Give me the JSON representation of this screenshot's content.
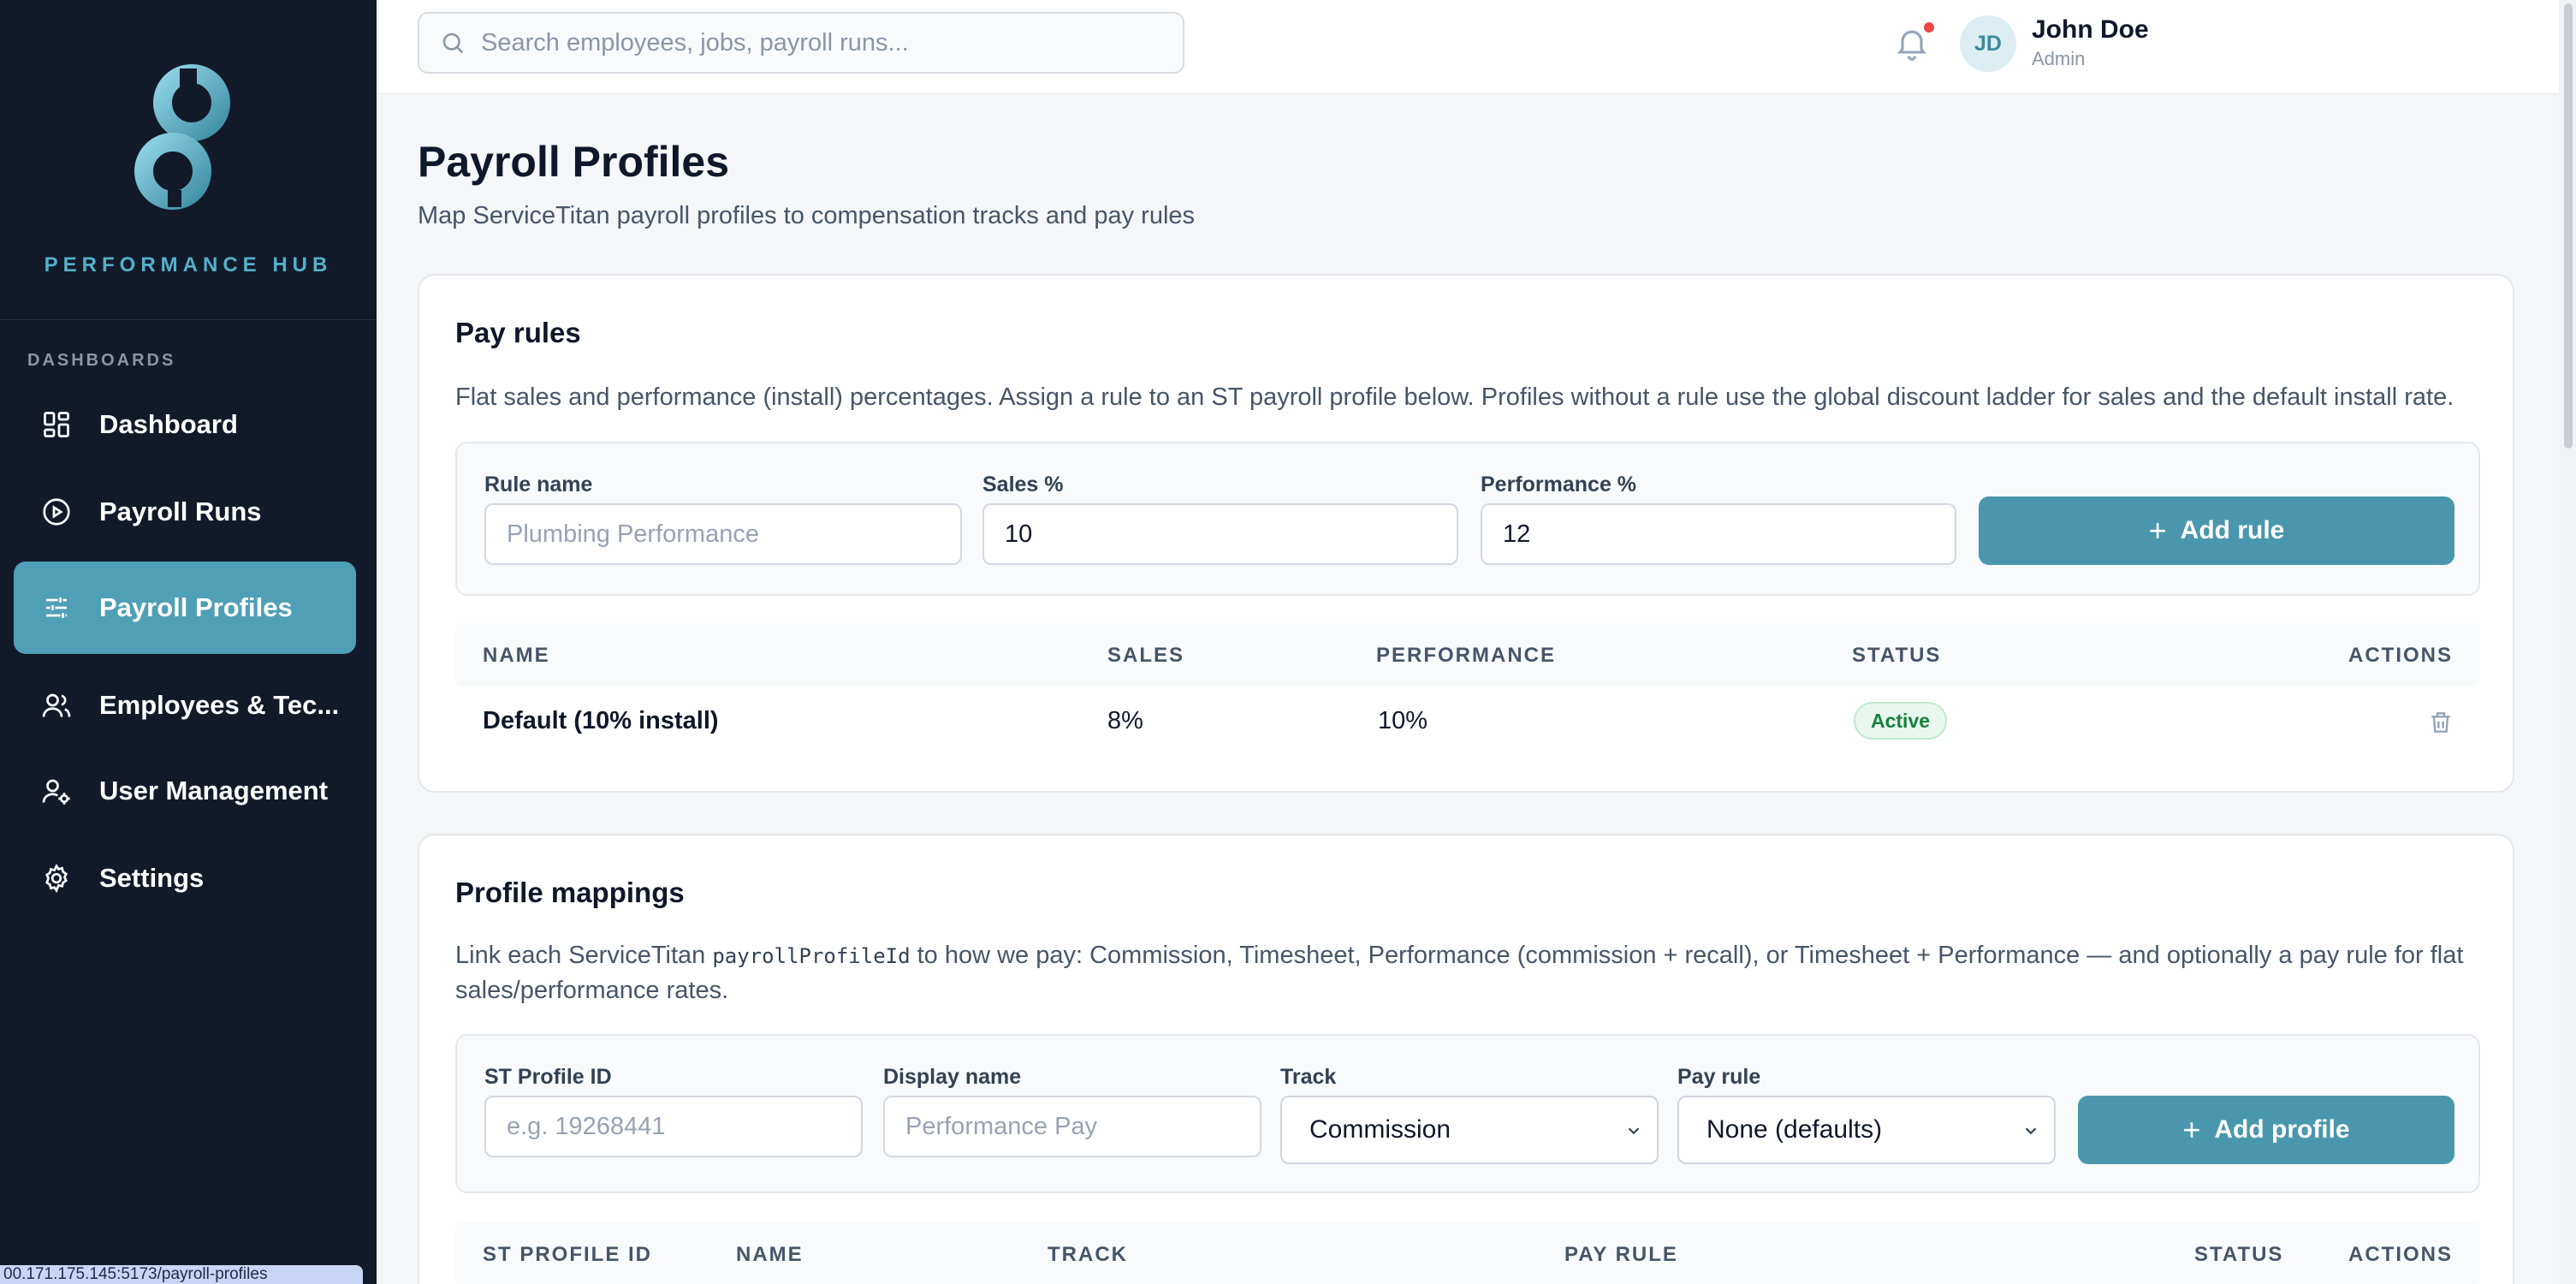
{
  "app": {
    "brand_name": "PERFORMANCE HUB",
    "status_url": "00.171.175.145:5173/payroll-profiles"
  },
  "sidebar": {
    "section_label": "DASHBOARDS",
    "items": [
      {
        "label": "Dashboard",
        "icon": "grid-icon",
        "active": false
      },
      {
        "label": "Payroll Runs",
        "icon": "play-circle-icon",
        "active": false
      },
      {
        "label": "Payroll Profiles",
        "icon": "sliders-icon",
        "active": true
      },
      {
        "label": "Employees & Tec...",
        "icon": "users-icon",
        "active": false
      },
      {
        "label": "User Management",
        "icon": "user-cog-icon",
        "active": false
      },
      {
        "label": "Settings",
        "icon": "gear-icon",
        "active": false
      }
    ]
  },
  "topbar": {
    "search_placeholder": "Search employees, jobs, payroll runs...",
    "user": {
      "initials": "JD",
      "name": "John Doe",
      "role": "Admin"
    },
    "notification_dot": true
  },
  "page": {
    "title": "Payroll Profiles",
    "subtitle": "Map ServiceTitan payroll profiles to compensation tracks and pay rules"
  },
  "pay_rules": {
    "title": "Pay rules",
    "description": "Flat sales and performance (install) percentages. Assign a rule to an ST payroll profile below. Profiles without a rule use the global discount ladder for sales and the default install rate.",
    "form": {
      "rule_name_label": "Rule name",
      "rule_name_placeholder": "Plumbing Performance",
      "sales_label": "Sales %",
      "sales_value": "10",
      "performance_label": "Performance %",
      "performance_value": "12",
      "add_button": "Add rule"
    },
    "table": {
      "headers": {
        "name": "NAME",
        "sales": "SALES",
        "performance": "PERFORMANCE",
        "status": "STATUS",
        "actions": "ACTIONS"
      },
      "rows": [
        {
          "name": "Default (10% install)",
          "sales": "8%",
          "performance": "10%",
          "status": "Active"
        }
      ]
    }
  },
  "profile_mappings": {
    "title": "Profile mappings",
    "desc_pre": "Link each ServiceTitan",
    "desc_code": "payrollProfileId",
    "desc_line1": "to how we pay: Commission, Timesheet, Performance (commission + recall), or Timesheet + Performance — and optionally a pay rule for flat",
    "desc_line2": "sales/performance rates.",
    "form": {
      "profile_id_label": "ST Profile ID",
      "profile_id_placeholder": "e.g. 19268441",
      "display_name_label": "Display name",
      "display_name_placeholder": "Performance Pay",
      "track_label": "Track",
      "track_value": "Commission",
      "pay_rule_label": "Pay rule",
      "pay_rule_value": "None (defaults)",
      "add_button": "Add profile"
    },
    "table": {
      "headers": {
        "profile_id": "ST PROFILE ID",
        "name": "NAME",
        "track": "TRACK",
        "pay_rule": "PAY RULE",
        "status": "STATUS",
        "actions": "ACTIONS"
      }
    }
  },
  "colors": {
    "sidebar_bg": "#121a2a",
    "accent": "#4a97ad",
    "active_nav": "#4f9fb6",
    "badge_green": "#15803d",
    "notification": "#ef4444"
  }
}
